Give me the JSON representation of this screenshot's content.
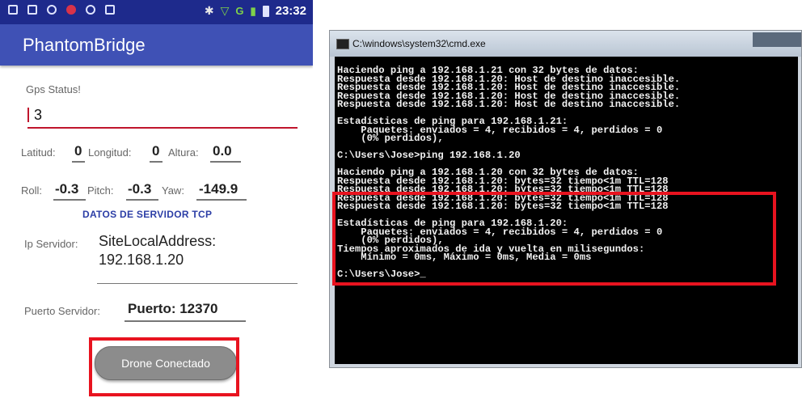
{
  "phone": {
    "status_bar": {
      "time": "23:32",
      "signal_label": "G"
    },
    "app_title": "PhantomBridge",
    "gps_status_label": "Gps Status!",
    "gps_value": "3",
    "latitud_label": "Latitud:",
    "latitud_value": "0",
    "longitud_label": "Longitud:",
    "longitud_value": "0",
    "altura_label": "Altura:",
    "altura_value": "0.0",
    "roll_label": "Roll:",
    "roll_value": "-0.3",
    "pitch_label": "Pitch:",
    "pitch_value": "-0.3",
    "yaw_label": "Yaw:",
    "yaw_value": "-149.9",
    "section_header": "DATOS DE SERVIDOR TCP",
    "ip_label": "Ip Servidor:",
    "ip_value_line1": "SiteLocalAddress:",
    "ip_value_line2": "192.168.1.20",
    "puerto_label": "Puerto Servidor:",
    "puerto_value": "Puerto: 12370",
    "drone_button": "Drone Conectado"
  },
  "cmd": {
    "title": "C:\\windows\\system32\\cmd.exe",
    "lines": [
      "Haciendo ping a 192.168.1.21 con 32 bytes de datos:",
      "Respuesta desde 192.168.1.20: Host de destino inaccesible.",
      "Respuesta desde 192.168.1.20: Host de destino inaccesible.",
      "Respuesta desde 192.168.1.20: Host de destino inaccesible.",
      "Respuesta desde 192.168.1.20: Host de destino inaccesible.",
      "",
      "Estadísticas de ping para 192.168.1.21:",
      "    Paquetes: enviados = 4, recibidos = 4, perdidos = 0",
      "    (0% perdidos),",
      "",
      "C:\\Users\\Jose>ping 192.168.1.20",
      "",
      "Haciendo ping a 192.168.1.20 con 32 bytes de datos:",
      "Respuesta desde 192.168.1.20: bytes=32 tiempo<1m TTL=128",
      "Respuesta desde 192.168.1.20: bytes=32 tiempo<1m TTL=128",
      "Respuesta desde 192.168.1.20: bytes=32 tiempo<1m TTL=128",
      "Respuesta desde 192.168.1.20: bytes=32 tiempo<1m TTL=128",
      "",
      "Estadísticas de ping para 192.168.1.20:",
      "    Paquetes: enviados = 4, recibidos = 4, perdidos = 0",
      "    (0% perdidos),",
      "Tiempos aproximados de ida y vuelta en milisegundos:",
      "    Mínimo = 0ms, Máximo = 0ms, Media = 0ms",
      "",
      "C:\\Users\\Jose>_"
    ]
  },
  "colors": {
    "status_bar": "#1e2a8c",
    "app_bar": "#3f51b5",
    "accent_red": "#e8131f",
    "console_bg": "#000000"
  }
}
